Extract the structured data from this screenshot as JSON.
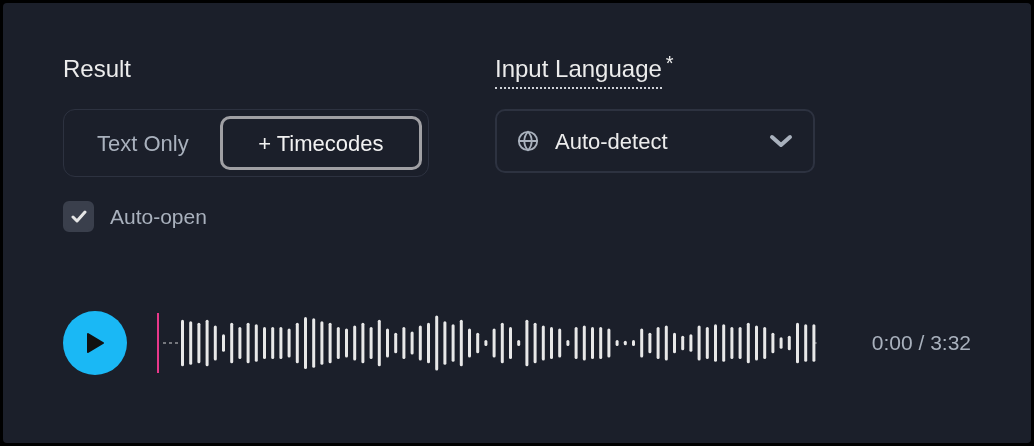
{
  "result": {
    "label": "Result",
    "options": [
      {
        "label": "Text Only",
        "selected": false
      },
      {
        "label": "+ Timecodes",
        "selected": true
      }
    ],
    "auto_open": {
      "label": "Auto-open",
      "checked": true
    }
  },
  "input_language": {
    "label": "Input Language",
    "required_mark": "*",
    "value": "Auto-detect"
  },
  "player": {
    "playing": false,
    "time": "0:00 / 3:32"
  }
}
